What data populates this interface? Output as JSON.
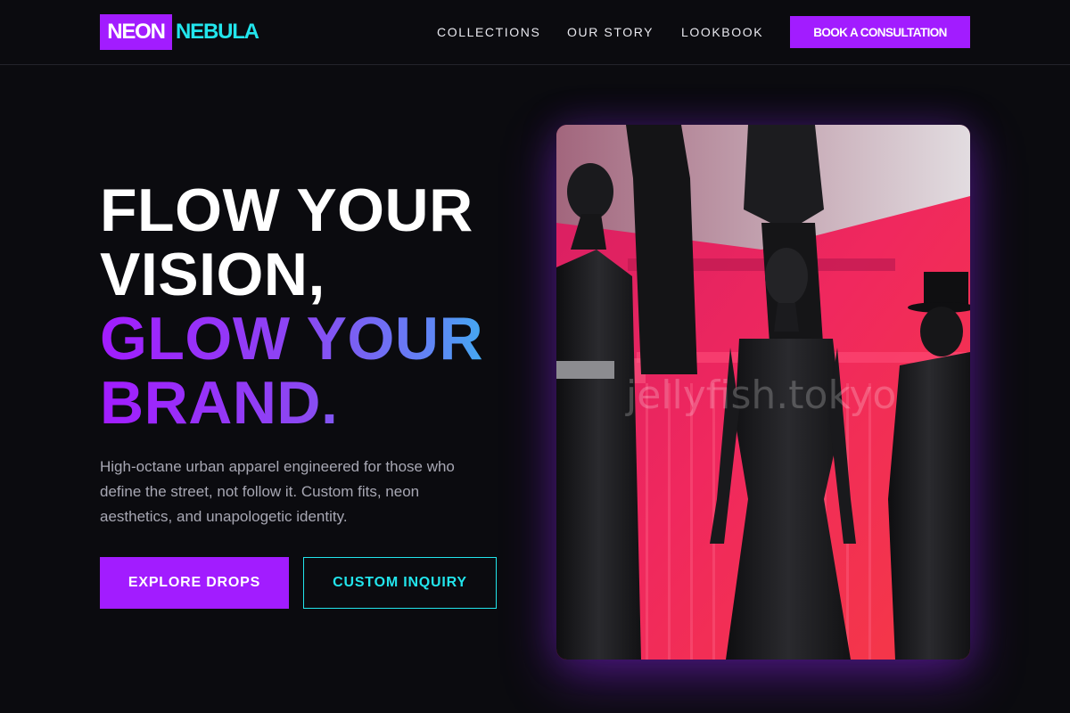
{
  "header": {
    "logo_part1": "NEON",
    "logo_part2": "NEBULA",
    "nav": [
      {
        "label": "COLLECTIONS"
      },
      {
        "label": "OUR STORY"
      },
      {
        "label": "LOOKBOOK"
      }
    ],
    "cta_label": "BOOK A CONSULTATION"
  },
  "hero": {
    "headline_line1": "FLOW YOUR",
    "headline_line2": "VISION,",
    "headline_line3": "GLOW YOUR",
    "headline_line4": "BRAND.",
    "description": "High-octane urban apparel engineered for those who define the street, not follow it. Custom fits, neon aesthetics, and unapologetic identity.",
    "primary_button": "EXPLORE DROPS",
    "secondary_button": "CUSTOM INQUIRY",
    "image_watermark": "jellyfish.tokyo"
  },
  "colors": {
    "background": "#0b0b0f",
    "accent_purple": "#a21cff",
    "accent_cyan": "#22e5ec",
    "text_muted": "#a7a7b3"
  }
}
